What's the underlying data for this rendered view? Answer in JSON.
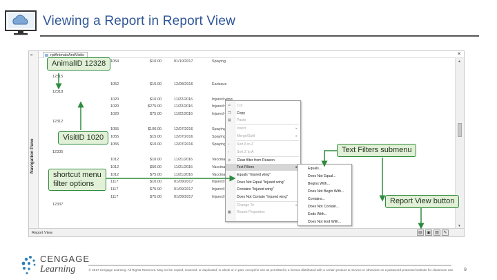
{
  "slide": {
    "title": "Viewing a Report in Report View",
    "page_number": "9",
    "brand_line1": "CENGAGE",
    "brand_line2": "Learning",
    "copyright": "© 2017 Cengage Learning. All Rights Reserved. May not be copied, scanned, or duplicated, in whole or in part, except for use as permitted in a license distributed with a certain product or service or otherwise on a password-protected website for classroom use."
  },
  "window": {
    "tab_label": "rptAnimalsAndVisits",
    "nav_pane_label": "Navigation Pane",
    "status_label": "Report View"
  },
  "report_rows": [
    {
      "group": "",
      "visit": "1054",
      "amount": "$10.00",
      "date": "01/10/2017",
      "reason": "Spaying"
    },
    {
      "group": "",
      "visit": "",
      "amount": "",
      "date": "",
      "reason": ""
    },
    {
      "group": "12315",
      "visit": "",
      "amount": "",
      "date": "",
      "reason": ""
    },
    {
      "group": "",
      "visit": "1052",
      "amount": "$15.00",
      "date": "12/08/2016",
      "reason": "Earissue"
    },
    {
      "group": "12318",
      "visit": "",
      "amount": "",
      "date": "",
      "reason": ""
    },
    {
      "group": "",
      "visit": "1020",
      "amount": "$10.00",
      "date": "11/22/2016",
      "reason": "Injured wing"
    },
    {
      "group": "",
      "visit": "1020",
      "amount": "$275.00",
      "date": "11/22/2016",
      "reason": "Injured wing"
    },
    {
      "group": "",
      "visit": "1020",
      "amount": "$75.00",
      "date": "11/22/2016",
      "reason": "Injured wing"
    },
    {
      "group": "12312",
      "visit": "",
      "amount": "",
      "date": "",
      "reason": ""
    },
    {
      "group": "",
      "visit": "1055",
      "amount": "$100.00",
      "date": "12/07/2016",
      "reason": "Spaying"
    },
    {
      "group": "",
      "visit": "1055",
      "amount": "$15.00",
      "date": "12/07/2016",
      "reason": "Spaying"
    },
    {
      "group": "",
      "visit": "1055",
      "amount": "$10.00",
      "date": "12/07/2016",
      "reason": "Spaying"
    },
    {
      "group": "12335",
      "visit": "",
      "amount": "",
      "date": "",
      "reason": ""
    },
    {
      "group": "",
      "visit": "1012",
      "amount": "$10.00",
      "date": "11/21/2016",
      "reason": "Vaccinations"
    },
    {
      "group": "",
      "visit": "1012",
      "amount": "$50.00",
      "date": "11/21/2016",
      "reason": "Vaccinations"
    },
    {
      "group": "",
      "visit": "1012",
      "amount": "$75.00",
      "date": "11/21/2016",
      "reason": "Vaccinations"
    },
    {
      "group": "",
      "visit": "1117",
      "amount": "$10.00",
      "date": "01/09/2017",
      "reason": "Injured leg"
    },
    {
      "group": "",
      "visit": "1117",
      "amount": "$75.00",
      "date": "01/09/2017",
      "reason": "Injured leg"
    },
    {
      "group": "",
      "visit": "1117",
      "amount": "$75.00",
      "date": "01/09/2017",
      "reason": "Injured leg"
    },
    {
      "group": "12337",
      "visit": "",
      "amount": "",
      "date": "",
      "reason": ""
    }
  ],
  "context_menu": [
    {
      "label": "Cut",
      "state": "disabled",
      "icon": "scissors-icon",
      "glyph": "✂"
    },
    {
      "label": "Copy",
      "state": "normal",
      "icon": "copy-icon",
      "glyph": "❐"
    },
    {
      "label": "Paste",
      "state": "disabled",
      "icon": "paste-icon",
      "glyph": "▤"
    },
    {
      "label": "Insert",
      "state": "disabled",
      "submenu": true
    },
    {
      "label": "Merge/Split",
      "state": "disabled",
      "submenu": true
    },
    {
      "label": "Sort A to Z",
      "state": "disabled",
      "icon": "sort-ascending-icon",
      "glyph": "↓"
    },
    {
      "label": "Sort Z to A",
      "state": "disabled",
      "icon": "sort-descending-icon",
      "glyph": "↑"
    },
    {
      "label": "Clear filter from Reason",
      "state": "normal",
      "icon": "clear-filter-icon",
      "glyph": "⊘"
    },
    {
      "label": "Text Filters",
      "state": "active",
      "submenu": true
    },
    {
      "label": "Equals \"Injured wing\"",
      "state": "normal"
    },
    {
      "label": "Does Not Equal \"Injured wing\"",
      "state": "normal"
    },
    {
      "label": "Contains \"Injured wing\"",
      "state": "normal"
    },
    {
      "label": "Does Not Contain \"Injured wing\"",
      "state": "normal"
    },
    {
      "label": "Change To",
      "state": "disabled",
      "submenu": true
    },
    {
      "label": "Report Properties",
      "state": "disabled",
      "icon": "properties-icon",
      "glyph": "▦"
    }
  ],
  "text_filters_submenu": [
    "Equals...",
    "Does Not Equal...",
    "Begins With...",
    "Does Not Begin With...",
    "Contains...",
    "Does Not Contain...",
    "Ends With...",
    "Does Not End With..."
  ],
  "callouts": {
    "animal_id": "AnimalID 12328",
    "visit_id": "VisitID 1020",
    "shortcut_menu": "shortcut menu\nfilter options",
    "text_filters": "Text Filters submenu",
    "report_view": "Report View button"
  },
  "colors": {
    "title_blue": "#2f5597",
    "callout_fill": "#e1f0d6",
    "callout_border": "#2e8b3d"
  }
}
